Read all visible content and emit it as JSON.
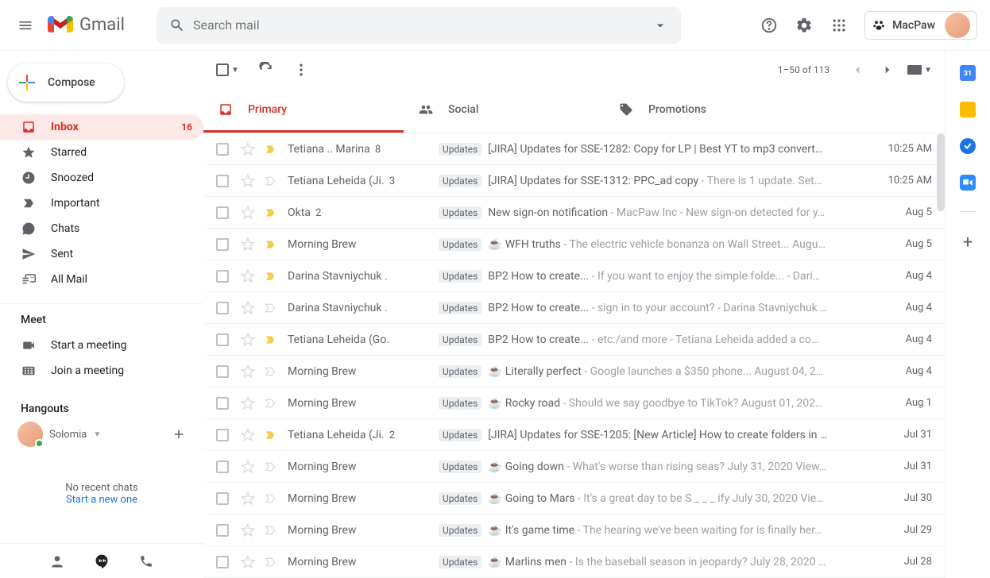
{
  "header": {
    "app_name": "Gmail",
    "search_placeholder": "Search mail",
    "brand_label": "MacPaw"
  },
  "compose_label": "Compose",
  "nav": [
    {
      "icon": "inbox",
      "label": "Inbox",
      "count": "16",
      "active": true
    },
    {
      "icon": "star",
      "label": "Starred"
    },
    {
      "icon": "clock",
      "label": "Snoozed"
    },
    {
      "icon": "important",
      "label": "Important"
    },
    {
      "icon": "chats",
      "label": "Chats"
    },
    {
      "icon": "sent",
      "label": "Sent"
    },
    {
      "icon": "allmail",
      "label": "All Mail"
    }
  ],
  "meet": {
    "title": "Meet",
    "items": [
      {
        "icon": "video",
        "label": "Start a meeting"
      },
      {
        "icon": "keyboard",
        "label": "Join a meeting"
      }
    ]
  },
  "hangouts": {
    "title": "Hangouts",
    "user": "Solomia",
    "no_chats": "No recent chats",
    "start_new": "Start a new one"
  },
  "toolbar": {
    "range": "1–50 of 113"
  },
  "tabs": [
    {
      "icon": "primary",
      "label": "Primary",
      "active": true
    },
    {
      "icon": "social",
      "label": "Social"
    },
    {
      "icon": "promo",
      "label": "Promotions"
    }
  ],
  "label_updates": "Updates",
  "emails": [
    {
      "sender": "Tetiana .. Marina",
      "count": "8",
      "important": true,
      "label": true,
      "emoji": "",
      "subject": "[JIRA] Updates for SSE-1282: Copy for LP | Best YT to mp3 convert…",
      "snippet": "",
      "date": "10:25 AM"
    },
    {
      "sender": "Tetiana Leheida (Ji.",
      "count": "3",
      "important": false,
      "label": true,
      "emoji": "",
      "subject": "[JIRA] Updates for SSE-1312: PPC_ad copy",
      "snippet": " - There is 1 update. Set…",
      "date": "10:25 AM"
    },
    {
      "sender": "Okta",
      "count": "2",
      "important": true,
      "label": true,
      "emoji": "",
      "subject": "New sign-on notification",
      "snippet": " - MacPaw Inc - New sign-on detected for y…",
      "date": "Aug 5"
    },
    {
      "sender": "Morning Brew",
      "count": "",
      "important": true,
      "label": true,
      "emoji": "☕",
      "subject": "WFH truths",
      "snippet": " - The electric vehicle bonanza on Wall Street... Augu…",
      "date": "Aug 5"
    },
    {
      "sender": "Darina Stavniychuk .",
      "count": "",
      "important": true,
      "label": true,
      "emoji": "",
      "subject": "BP2 How to create...",
      "snippet": " - If you want to enjoy the simple folde... - Dari…",
      "date": "Aug 4"
    },
    {
      "sender": "Darina Stavniychuk .",
      "count": "",
      "important": false,
      "label": true,
      "emoji": "",
      "subject": "BP2 How to create...",
      "snippet": " - sign in to your account? - Darina Stavniychuk …",
      "date": "Aug 4"
    },
    {
      "sender": "Tetiana Leheida (Go.",
      "count": "",
      "important": true,
      "label": true,
      "emoji": "",
      "subject": "BP2 How to create...",
      "snippet": " - etc./and more - Tetiana Leheida added a co…",
      "date": "Aug 4"
    },
    {
      "sender": "Morning Brew",
      "count": "",
      "important": false,
      "label": true,
      "emoji": "☕",
      "subject": "Literally perfect",
      "snippet": " - Google launches a $350 phone... August 04, 2…",
      "date": "Aug 4"
    },
    {
      "sender": "Morning Brew",
      "count": "",
      "important": false,
      "label": true,
      "emoji": "☕",
      "subject": "Rocky road",
      "snippet": " - Should we say goodbye to TikTok? August 01, 202…",
      "date": "Aug 1"
    },
    {
      "sender": "Tetiana Leheida (Ji.",
      "count": "2",
      "important": true,
      "label": true,
      "emoji": "",
      "subject": "[JIRA] Updates for SSE-1205: [New Article] How to create folders in …",
      "snippet": "",
      "date": "Jul 31"
    },
    {
      "sender": "Morning Brew",
      "count": "",
      "important": false,
      "label": true,
      "emoji": "☕",
      "subject": "Going down",
      "snippet": " - What's worse than rising seas? July 31, 2020 View…",
      "date": "Jul 31"
    },
    {
      "sender": "Morning Brew",
      "count": "",
      "important": false,
      "label": true,
      "emoji": "☕",
      "subject": "Going to Mars",
      "snippet": " - It's a great day to be S _ _ _ ify July 30, 2020 Vie…",
      "date": "Jul 30"
    },
    {
      "sender": "Morning Brew",
      "count": "",
      "important": false,
      "label": true,
      "emoji": "☕",
      "subject": "It's game time",
      "snippet": " - The hearing we've been waiting for is finally her…",
      "date": "Jul 29"
    },
    {
      "sender": "Morning Brew",
      "count": "",
      "important": false,
      "label": true,
      "emoji": "☕",
      "subject": "Marlins men",
      "snippet": " - Is the baseball season in jeopardy? July 28, 2020 …",
      "date": "Jul 28"
    }
  ]
}
